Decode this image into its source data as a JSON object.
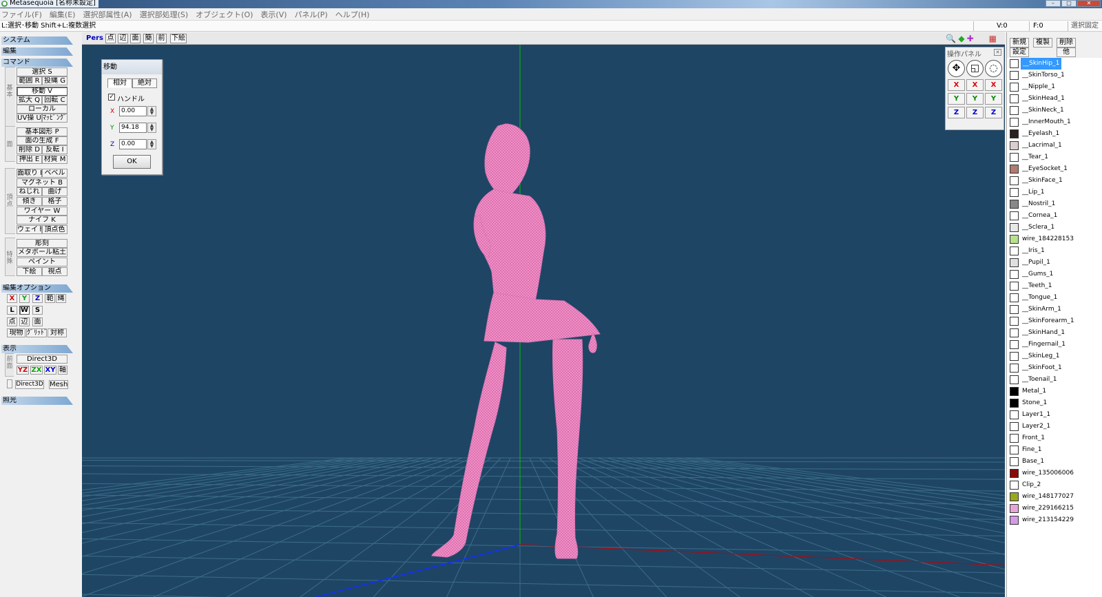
{
  "window": {
    "title": "Metasequoia [名称未設定]"
  },
  "menu": [
    "ファイル(F)",
    "編集(E)",
    "選択部属性(A)",
    "選択部処理(S)",
    "オブジェクト(O)",
    "表示(V)",
    "パネル(P)",
    "ヘルプ(H)"
  ],
  "status": {
    "hint": "L:選択･移動  Shift+L:複数選択",
    "v": "V:0",
    "f": "F:0",
    "mode": "選択固定"
  },
  "left": {
    "sections": {
      "system": "システム",
      "edit": "編集",
      "command": "コマンド",
      "edit_option": "編集オプション",
      "display": "表示",
      "lighting": "照光"
    },
    "groups": {
      "basic": "基本",
      "face": "面",
      "vertex": "頂点",
      "special": "特殊",
      "front": "前面"
    },
    "cmd": {
      "select": "選択 S",
      "range": "範囲 R",
      "project": "投縄 G",
      "move": "移動 V",
      "scale": "拡大 Q",
      "rotate": "回転 C",
      "local": "ローカル",
      "uv": "UV操 U",
      "mapping": "ﾏｯﾋﾟﾝｸﾞ",
      "primitive": "基本図形 P",
      "face_gen": "面の生成 F",
      "delete": "削除 D",
      "flip": "反転 I",
      "extrude": "押出 E",
      "material": "材質 M",
      "chamfer": "面取り H",
      "bevel": "ベベル",
      "magnet": "マグネット B",
      "twist": "ねじれ",
      "bend": "曲げ",
      "tilt": "傾き",
      "lattice": "格子",
      "wire": "ワイヤー W",
      "knife": "ナイフ K",
      "weight": "ウェイト",
      "vcolor": "頂点色",
      "sculpt": "彫刻",
      "metaball": "メタボール粘土",
      "paint": "ペイント",
      "underlay": "下絵",
      "viewpoint": "視点"
    },
    "opt": {
      "x": "X",
      "y": "Y",
      "z": "Z",
      "rng": "範",
      "lasso": "縄",
      "l": "L",
      "w": "W",
      "s": "S",
      "pt": "点",
      "ed": "辺",
      "fc": "面",
      "cur": "現物",
      "grid": "ｸﾞﾘｯﾄﾞ",
      "sym": "対称"
    },
    "disp": {
      "d3d": "Direct3D",
      "yz": "YZ",
      "zx": "ZX",
      "xy": "XY",
      "axis": "軸",
      "d3d2": "Direct3D",
      "mesh": "Mesh"
    }
  },
  "viewport": {
    "mode": "Pers",
    "buttons": [
      "点",
      "辺",
      "面",
      "簡",
      "前",
      "下絵"
    ],
    "background": "#1f4565",
    "mesh_color": "#f08cc8"
  },
  "move_dialog": {
    "title": "移動",
    "tab_rel": "相対",
    "tab_abs": "絶対",
    "handle": "ハンドル",
    "x_label": "X",
    "x": "0.00",
    "y_label": "Y",
    "y": "94.18",
    "z_label": "Z",
    "z": "0.00",
    "ok": "OK"
  },
  "op_panel": {
    "title": "操作パネル",
    "x": "X",
    "y": "Y",
    "z": "Z"
  },
  "objects": {
    "new": "新規",
    "dup": "複製",
    "del": "削除",
    "settings": "設定",
    "other": "他",
    "items": [
      {
        "name": "__SkinHip_1",
        "color": "#ffffff",
        "selected": true
      },
      {
        "name": "__SkinTorso_1",
        "color": "#ffffff"
      },
      {
        "name": "__Nipple_1",
        "color": "#ffffff"
      },
      {
        "name": "__SkinHead_1",
        "color": "#ffffff"
      },
      {
        "name": "__SkinNeck_1",
        "color": "#ffffff"
      },
      {
        "name": "__InnerMouth_1",
        "color": "#ffffff"
      },
      {
        "name": "__Eyelash_1",
        "color": "#2a2220"
      },
      {
        "name": "__Lacrimal_1",
        "color": "#d9cfcf"
      },
      {
        "name": "__Tear_1",
        "color": "#ffffff"
      },
      {
        "name": "__EyeSocket_1",
        "color": "#b07b70"
      },
      {
        "name": "__SkinFace_1",
        "color": "#ffffff"
      },
      {
        "name": "__Lip_1",
        "color": "#ffffff"
      },
      {
        "name": "__Nostril_1",
        "color": "#888888"
      },
      {
        "name": "__Cornea_1",
        "color": "#ffffff"
      },
      {
        "name": "__Sclera_1",
        "color": "#e8e8e8"
      },
      {
        "name": "wire_184228153",
        "color": "#b8e08e"
      },
      {
        "name": "__Iris_1",
        "color": "#ffffff"
      },
      {
        "name": "__Pupil_1",
        "color": "#e0e0e0"
      },
      {
        "name": "__Gums_1",
        "color": "#ffffff"
      },
      {
        "name": "__Teeth_1",
        "color": "#ffffff"
      },
      {
        "name": "__Tongue_1",
        "color": "#ffffff"
      },
      {
        "name": "__SkinArm_1",
        "color": "#ffffff"
      },
      {
        "name": "__SkinForearm_1",
        "color": "#ffffff"
      },
      {
        "name": "__SkinHand_1",
        "color": "#ffffff"
      },
      {
        "name": "__Fingernail_1",
        "color": "#ffffff"
      },
      {
        "name": "__SkinLeg_1",
        "color": "#ffffff"
      },
      {
        "name": "__SkinFoot_1",
        "color": "#ffffff"
      },
      {
        "name": "__Toenail_1",
        "color": "#ffffff"
      },
      {
        "name": "Metal_1",
        "color": "#000000"
      },
      {
        "name": "Stone_1",
        "color": "#000000"
      },
      {
        "name": "Layer1_1",
        "color": "#ffffff"
      },
      {
        "name": "Layer2_1",
        "color": "#ffffff"
      },
      {
        "name": "Front_1",
        "color": "#ffffff"
      },
      {
        "name": "Fine_1",
        "color": "#ffffff"
      },
      {
        "name": "Base_1",
        "color": "#ffffff"
      },
      {
        "name": "wire_135006006",
        "color": "#8a0a0a"
      },
      {
        "name": "Clip_2",
        "color": "#ffffff"
      },
      {
        "name": "wire_148177027",
        "color": "#9aa81e"
      },
      {
        "name": "wire_229166215",
        "color": "#e5a6d7"
      },
      {
        "name": "wire_213154229",
        "color": "#d59ae5"
      }
    ]
  }
}
